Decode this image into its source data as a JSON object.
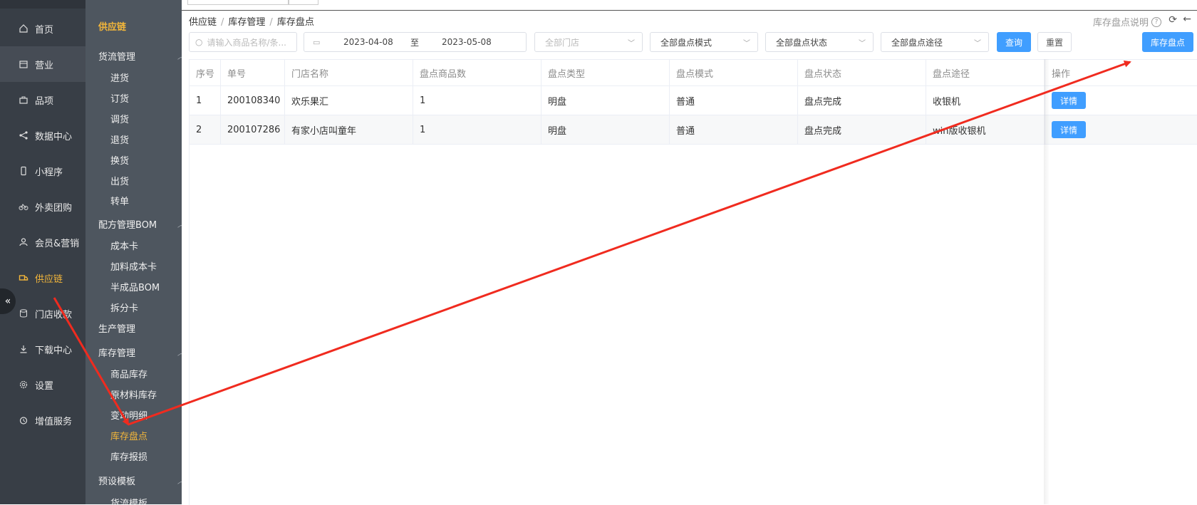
{
  "nav": {
    "items": [
      {
        "label": "首页",
        "icon": "home-icon"
      },
      {
        "label": "营业",
        "icon": "calendar-icon"
      },
      {
        "label": "品项",
        "icon": "bag-icon"
      },
      {
        "label": "数据中心",
        "icon": "share-icon"
      },
      {
        "label": "小程序",
        "icon": "phone-icon"
      },
      {
        "label": "外卖团购",
        "icon": "bike-icon"
      },
      {
        "label": "会员&营销",
        "icon": "user-icon"
      },
      {
        "label": "供应链",
        "icon": "truck-icon"
      },
      {
        "label": "门店收款",
        "icon": "database-icon"
      },
      {
        "label": "下载中心",
        "icon": "download-icon"
      },
      {
        "label": "设置",
        "icon": "gear-icon"
      },
      {
        "label": "增值服务",
        "icon": "clock-icon"
      }
    ],
    "collapse_glyph": "«"
  },
  "subnav": {
    "title": "供应链",
    "entries": [
      {
        "label": "货流管理",
        "kind": "group"
      },
      {
        "label": "进货",
        "kind": "sub"
      },
      {
        "label": "订货",
        "kind": "sub"
      },
      {
        "label": "调货",
        "kind": "sub"
      },
      {
        "label": "退货",
        "kind": "sub"
      },
      {
        "label": "换货",
        "kind": "sub"
      },
      {
        "label": "出货",
        "kind": "sub"
      },
      {
        "label": "转单",
        "kind": "sub"
      },
      {
        "label": "配方管理BOM",
        "kind": "group"
      },
      {
        "label": "成本卡",
        "kind": "sub"
      },
      {
        "label": "加料成本卡",
        "kind": "sub"
      },
      {
        "label": "半成品BOM",
        "kind": "sub"
      },
      {
        "label": "拆分卡",
        "kind": "sub"
      },
      {
        "label": "生产管理",
        "kind": "plain"
      },
      {
        "label": "库存管理",
        "kind": "group"
      },
      {
        "label": "商品库存",
        "kind": "sub"
      },
      {
        "label": "原材料库存",
        "kind": "sub"
      },
      {
        "label": "变动明细",
        "kind": "sub"
      },
      {
        "label": "库存盘点",
        "kind": "sub-active"
      },
      {
        "label": "库存报损",
        "kind": "sub"
      },
      {
        "label": "预设模板",
        "kind": "group"
      },
      {
        "label": "货流模板",
        "kind": "sub"
      }
    ]
  },
  "breadcrumb": [
    "供应链",
    "库存管理",
    "库存盘点"
  ],
  "help_label": "库存盘点说明",
  "filters": {
    "search_placeholder": "请输入商品名称/条...",
    "date_start": "2023-04-08",
    "date_to": "至",
    "date_end": "2023-05-08",
    "store_placeholder": "全部门店",
    "mode": "全部盘点模式",
    "status": "全部盘点状态",
    "path": "全部盘点途径",
    "query_label": "查询",
    "reset_label": "重置",
    "stock_label": "库存盘点"
  },
  "table": {
    "columns": [
      "序号",
      "单号",
      "门店名称",
      "盘点商品数",
      "盘点类型",
      "盘点模式",
      "盘点状态",
      "盘点途径",
      "操作"
    ],
    "rows": [
      [
        "1",
        "200108340",
        "欢乐果汇",
        "1",
        "明盘",
        "普通",
        "盘点完成",
        "收银机",
        "详情"
      ],
      [
        "2",
        "200107286",
        "有家小店叫童年",
        "1",
        "明盘",
        "普通",
        "盘点完成",
        "win版收银机",
        "详情"
      ]
    ]
  },
  "colors": {
    "nav_bg": "#383e46",
    "subnav_bg": "#4e565f",
    "accent": "#f3b63a",
    "primary": "#409eff",
    "annotation_arrow": "#f02b1f"
  }
}
